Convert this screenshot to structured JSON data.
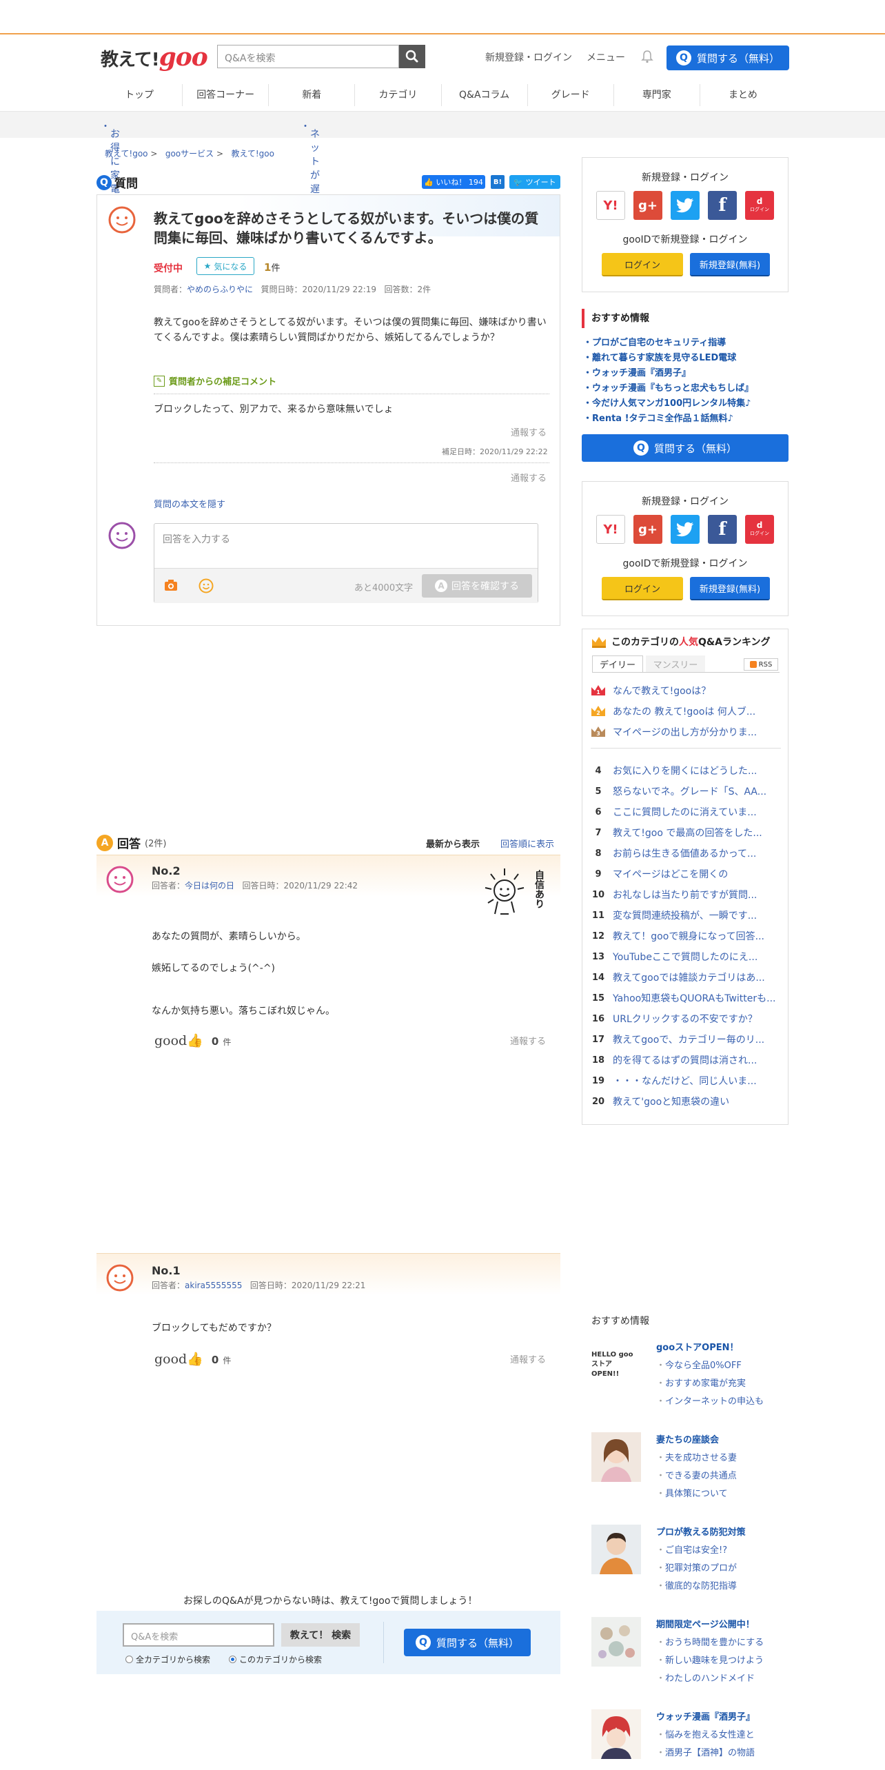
{
  "header": {
    "logo_text": "教えて!",
    "logo_goo": "goo",
    "search_placeholder": "Q&Aを検索",
    "register_login": "新規登録・ログイン",
    "menu": "メニュー",
    "ask_button": "質問する（無料）"
  },
  "nav": [
    "トップ",
    "回答コーナー",
    "新着",
    "カテゴリ",
    "Q&Aコラム",
    "グレード",
    "専門家",
    "まとめ"
  ],
  "promo": [
    "お得に家電買うならgooストア",
    "ネットが遅くてイライラしてない!?"
  ],
  "breadcrumb": [
    "教えて!goo",
    "gooサービス",
    "教えて!goo"
  ],
  "question": {
    "section_label": "質問",
    "like_label": "いいね！ 194",
    "hatena_label": "B!",
    "tweet_label": "ツイート",
    "title": "教えてgooを辞めさそうとしてる奴がいます。そいつは僕の質問集に毎回、嫌味ばかり書いてくるんですよ。",
    "status": "受付中",
    "watch_label": "気になる",
    "watch_count": "1",
    "watch_unit": "件",
    "meta_asker_label": "質問者：",
    "asker": "やめのらふりやに",
    "meta_time": "質問日時：2020/11/29 22:19",
    "meta_count": "回答数：2件",
    "body": "教えてgooを辞めさそうとしてる奴がいます。そいつは僕の質問集に毎回、嫌味ばかり書いてくるんですよ。僕は素晴らしい質問ばかりだから、嫉妬してるんでしょうか？",
    "supplement_label": "質問者からの補足コメント",
    "supplement_body": "ブロックしたって、別アカで、来るから意味無いでしょ",
    "report": "通報する",
    "supplement_time": "補足日時：2020/11/29 22:22",
    "report2": "通報する",
    "hide_body": "質問の本文を隠す",
    "answer_placeholder": "回答を入力する",
    "chars_left": "あと4000文字",
    "confirm_button": "回答を確認する"
  },
  "answers": {
    "label": "回答",
    "count": "(2件)",
    "sort_new": "最新から表示",
    "sort_old": "回答順に表示",
    "items": [
      {
        "no": "No.2",
        "answerer_label": "回答者：",
        "answerer": "今日は何の日",
        "time": "回答日時：2020/11/29 22:42",
        "lines": [
          "あなたの質問が、素晴らしいから。",
          "嫉妬してるのでしょう(^-^)",
          "なんか気持ち悪い。落ちこぼれ奴じゃん。"
        ],
        "good_label": "good",
        "good_count": "0",
        "good_unit": "件",
        "report": "通報する",
        "badge": "自信あり"
      },
      {
        "no": "No.1",
        "answerer_label": "回答者：",
        "answerer": "akira5555555",
        "time": "回答日時：2020/11/29 22:21",
        "lines": [
          "ブロックしてもだめですか？"
        ],
        "good_label": "good",
        "good_count": "0",
        "good_unit": "件",
        "report": "通報する"
      }
    ]
  },
  "bottom_search": {
    "message": "お探しのQ&Aが見つからない時は、教えて!gooで質問しましょう！",
    "placeholder": "Q&Aを検索",
    "button": "教えて！ 検索",
    "radio_all": "全カテゴリから検索",
    "radio_this": "このカテゴリから検索",
    "ask_button": "質問する（無料）"
  },
  "sidebar": {
    "login_title": "新規登録・ログイン",
    "sns": [
      "Y!",
      "g+",
      "twitter",
      "f",
      "d"
    ],
    "sns_d_label": "ログイン",
    "gooid": "gooIDで新規登録・ログイン",
    "login_button": "ログイン",
    "register_button": "新規登録(無料)",
    "recommend_title": "おすすめ情報",
    "recommend_items": [
      "・プロがご自宅のセキュリティ指導",
      "・離れて暮らす家族を見守るLED電球",
      "・ウォッチ漫画『酒男子』",
      "・ウォッチ漫画『もちっと忠犬もちしば』",
      "・今だけ人気マンガ100円レンタル特集♪",
      "・Renta !タテコミ全作品１話無料♪"
    ],
    "ask_button": "質問する（無料）",
    "ranking": {
      "title_pre": "このカテゴリの",
      "title_hot": "人気",
      "title_post": "Q&Aランキング",
      "tab_daily": "デイリー",
      "tab_monthly": "マンスリー",
      "rss": "RSS",
      "items": [
        "なんで教えて!gooは？",
        "あなたの 教えて!gooは 何人ブ...",
        "マイページの出し方が分かりま...",
        "お気に入りを開くにはどうした...",
        "怒らないでネ。グレード「S、AA...",
        "ここに質問したのに消えていま...",
        "教えて!goo で最高の回答をした...",
        "お前らは生きる価値あるかって...",
        "マイページはどこを開くの",
        "お礼なしは当たり前ですが質問...",
        "変な質問連続投稿が、一瞬です...",
        "教えて！gooで親身になって回答...",
        "YouTubeここで質問したのにえ...",
        "教えてgooでは雑談カテゴリはあ...",
        "Yahoo知恵袋もQUORAもTwitterも...",
        "URLクリックするの不安ですか？",
        "教えてgooで、カテゴリー毎のリ...",
        "的を得てるはずの質問は消され...",
        "・・・なんだけど、同じ人いま...",
        "教えて'gooと知恵袋の違い"
      ]
    },
    "osusume2_title": "おすすめ情報",
    "ads": [
      {
        "title": "gooストアOPEN！",
        "links": [
          "今なら全品0%OFF",
          "おすすめ家電が充実",
          "インターネットの申込も"
        ],
        "img_text": "HELLO goo ストア OPEN!!"
      },
      {
        "title": "妻たちの座談会",
        "links": [
          "夫を成功させる妻",
          "できる妻の共通点",
          "具体策について"
        ]
      },
      {
        "title": "プロが教える防犯対策",
        "links": [
          "ご自宅は安全!?",
          "犯罪対策のプロが",
          "徹底的な防犯指導"
        ]
      },
      {
        "title": "期間限定ページ公開中！",
        "links": [
          "おうち時間を豊かにする",
          "新しい趣味を見つけよう",
          "わたしのハンドメイド"
        ]
      },
      {
        "title": "ウォッチ漫画『酒男子』",
        "links": [
          "悩みを抱える女性達と",
          "酒男子【酒神】の物語"
        ]
      }
    ]
  },
  "colors": {
    "accent_orange": "#f0a04b",
    "primary_blue": "#1a6fdc",
    "link_blue": "#3a62b0",
    "status_red": "#e5333f",
    "login_yellow": "#f5c518"
  }
}
